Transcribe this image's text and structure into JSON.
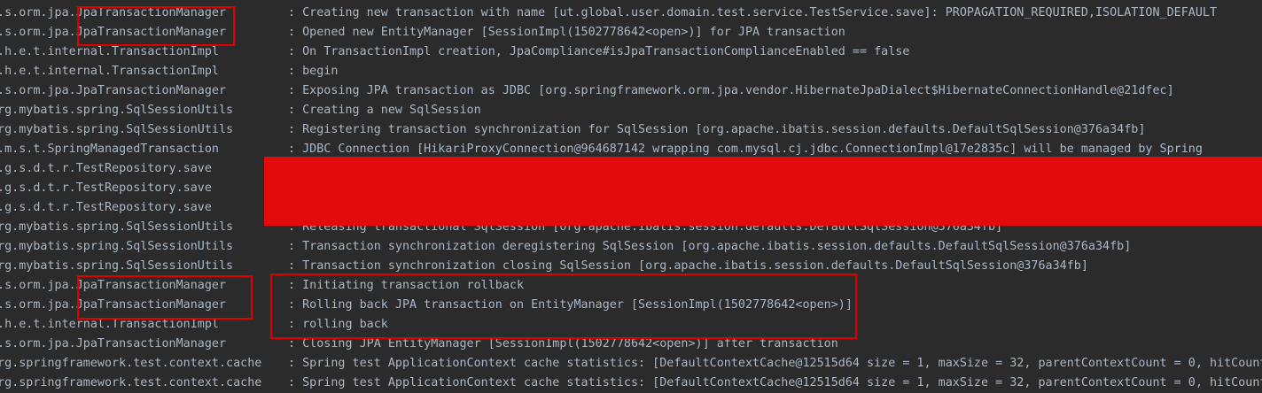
{
  "log_lines": [
    {
      "logger": "o.s.orm.jpa.JpaTransactionManager",
      "message": ": Creating new transaction with name [ut.global.user.domain.test.service.TestService.save]: PROPAGATION_REQUIRED,ISOLATION_DEFAULT"
    },
    {
      "logger": "o.s.orm.jpa.JpaTransactionManager",
      "message": ": Opened new EntityManager [SessionImpl(1502778642<open>)] for JPA transaction"
    },
    {
      "logger": "o.h.e.t.internal.TransactionImpl",
      "message": ": On TransactionImpl creation, JpaCompliance#isJpaTransactionComplianceEnabled == false"
    },
    {
      "logger": "o.h.e.t.internal.TransactionImpl",
      "message": ": begin"
    },
    {
      "logger": "o.s.orm.jpa.JpaTransactionManager",
      "message": ": Exposing JPA transaction as JDBC [org.springframework.orm.jpa.vendor.HibernateJpaDialect$HibernateConnectionHandle@21dfec]"
    },
    {
      "logger": "org.mybatis.spring.SqlSessionUtils",
      "message": ": Creating a new SqlSession"
    },
    {
      "logger": "org.mybatis.spring.SqlSessionUtils",
      "message": ": Registering transaction synchronization for SqlSession [org.apache.ibatis.session.defaults.DefaultSqlSession@376a34fb]"
    },
    {
      "logger": "o.m.s.t.SpringManagedTransaction",
      "message": ": JDBC Connection [HikariProxyConnection@964687142 wrapping com.mysql.cj.jdbc.ConnectionImpl@17e2835c] will be managed by Spring"
    },
    {
      "logger": "u.g.s.d.t.r.TestRepository.save",
      "message": ""
    },
    {
      "logger": "u.g.s.d.t.r.TestRepository.save",
      "message": ""
    },
    {
      "logger": "u.g.s.d.t.r.TestRepository.save",
      "message": ""
    },
    {
      "logger": "org.mybatis.spring.SqlSessionUtils",
      "message": ": Releasing transactional SqlSession [org.apache.ibatis.session.defaults.DefaultSqlSession@376a34fb]"
    },
    {
      "logger": "org.mybatis.spring.SqlSessionUtils",
      "message": ": Transaction synchronization deregistering SqlSession [org.apache.ibatis.session.defaults.DefaultSqlSession@376a34fb]"
    },
    {
      "logger": "org.mybatis.spring.SqlSessionUtils",
      "message": ": Transaction synchronization closing SqlSession [org.apache.ibatis.session.defaults.DefaultSqlSession@376a34fb]"
    },
    {
      "logger": "o.s.orm.jpa.JpaTransactionManager",
      "message": ": Initiating transaction rollback"
    },
    {
      "logger": "o.s.orm.jpa.JpaTransactionManager",
      "message": ": Rolling back JPA transaction on EntityManager [SessionImpl(1502778642<open>)]"
    },
    {
      "logger": "o.h.e.t.internal.TransactionImpl",
      "message": ": rolling back"
    },
    {
      "logger": "o.s.orm.jpa.JpaTransactionManager",
      "message": ": Closing JPA EntityManager [SessionImpl(1502778642<open>)] after transaction"
    },
    {
      "logger": "org.springframework.test.context.cache",
      "message": ": Spring test ApplicationContext cache statistics: [DefaultContextCache@12515d64 size = 1, maxSize = 32, parentContextCount = 0, hitCount"
    },
    {
      "logger": "org.springframework.test.context.cache",
      "message": ": Spring test ApplicationContext cache statistics: [DefaultContextCache@12515d64 size = 1, maxSize = 32, parentContextCount = 0, hitCount"
    }
  ],
  "colors": {
    "background": "#2b2b2b",
    "text": "#a9b7c6",
    "highlight_border": "#e00000",
    "redaction": "#e20a0a"
  }
}
